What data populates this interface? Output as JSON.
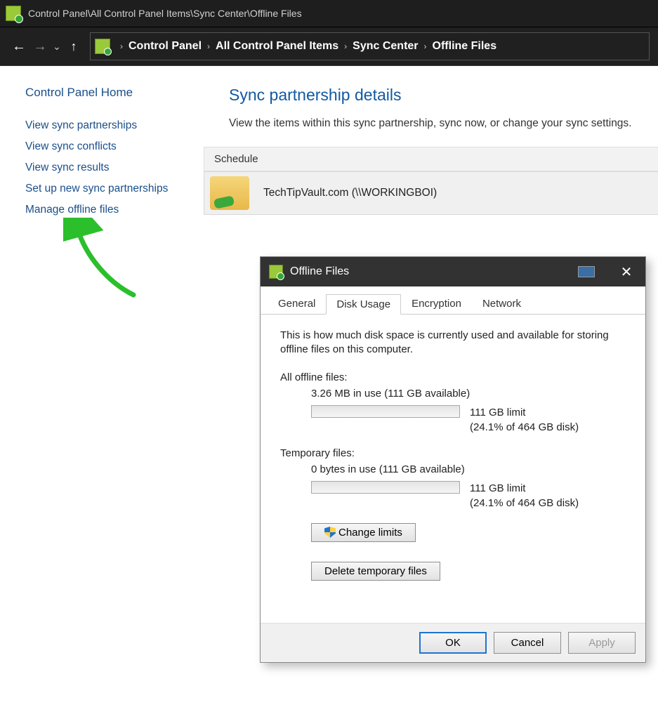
{
  "window": {
    "title_path": "Control Panel\\All Control Panel Items\\Sync Center\\Offline Files"
  },
  "breadcrumb": {
    "items": [
      "Control Panel",
      "All Control Panel Items",
      "Sync Center",
      "Offline Files"
    ]
  },
  "sidebar": {
    "home": "Control Panel Home",
    "links": [
      "View sync partnerships",
      "View sync conflicts",
      "View sync results",
      "Set up new sync partnerships",
      "Manage offline files"
    ]
  },
  "content": {
    "heading": "Sync partnership details",
    "description": "View the items within this sync partnership, sync now, or change your sync settings.",
    "toolbar": {
      "schedule": "Schedule"
    },
    "partnership": {
      "name": "TechTipVault.com (\\\\WORKINGBOI)"
    }
  },
  "dialog": {
    "title": "Offline Files",
    "tabs": [
      "General",
      "Disk Usage",
      "Encryption",
      "Network"
    ],
    "active_tab": "Disk Usage",
    "desc": "This is how much disk space is currently used and available for storing offline files on this computer.",
    "all_files": {
      "label": "All offline files:",
      "usage": "3.26 MB in use (111 GB available)",
      "limit": "111 GB limit",
      "percent": "(24.1% of 464 GB disk)"
    },
    "temp_files": {
      "label": "Temporary files:",
      "usage": "0 bytes in use (111 GB available)",
      "limit": "111 GB limit",
      "percent": "(24.1% of 464 GB disk)"
    },
    "change_limits": "Change limits",
    "delete_temp": "Delete temporary files",
    "buttons": {
      "ok": "OK",
      "cancel": "Cancel",
      "apply": "Apply"
    }
  }
}
